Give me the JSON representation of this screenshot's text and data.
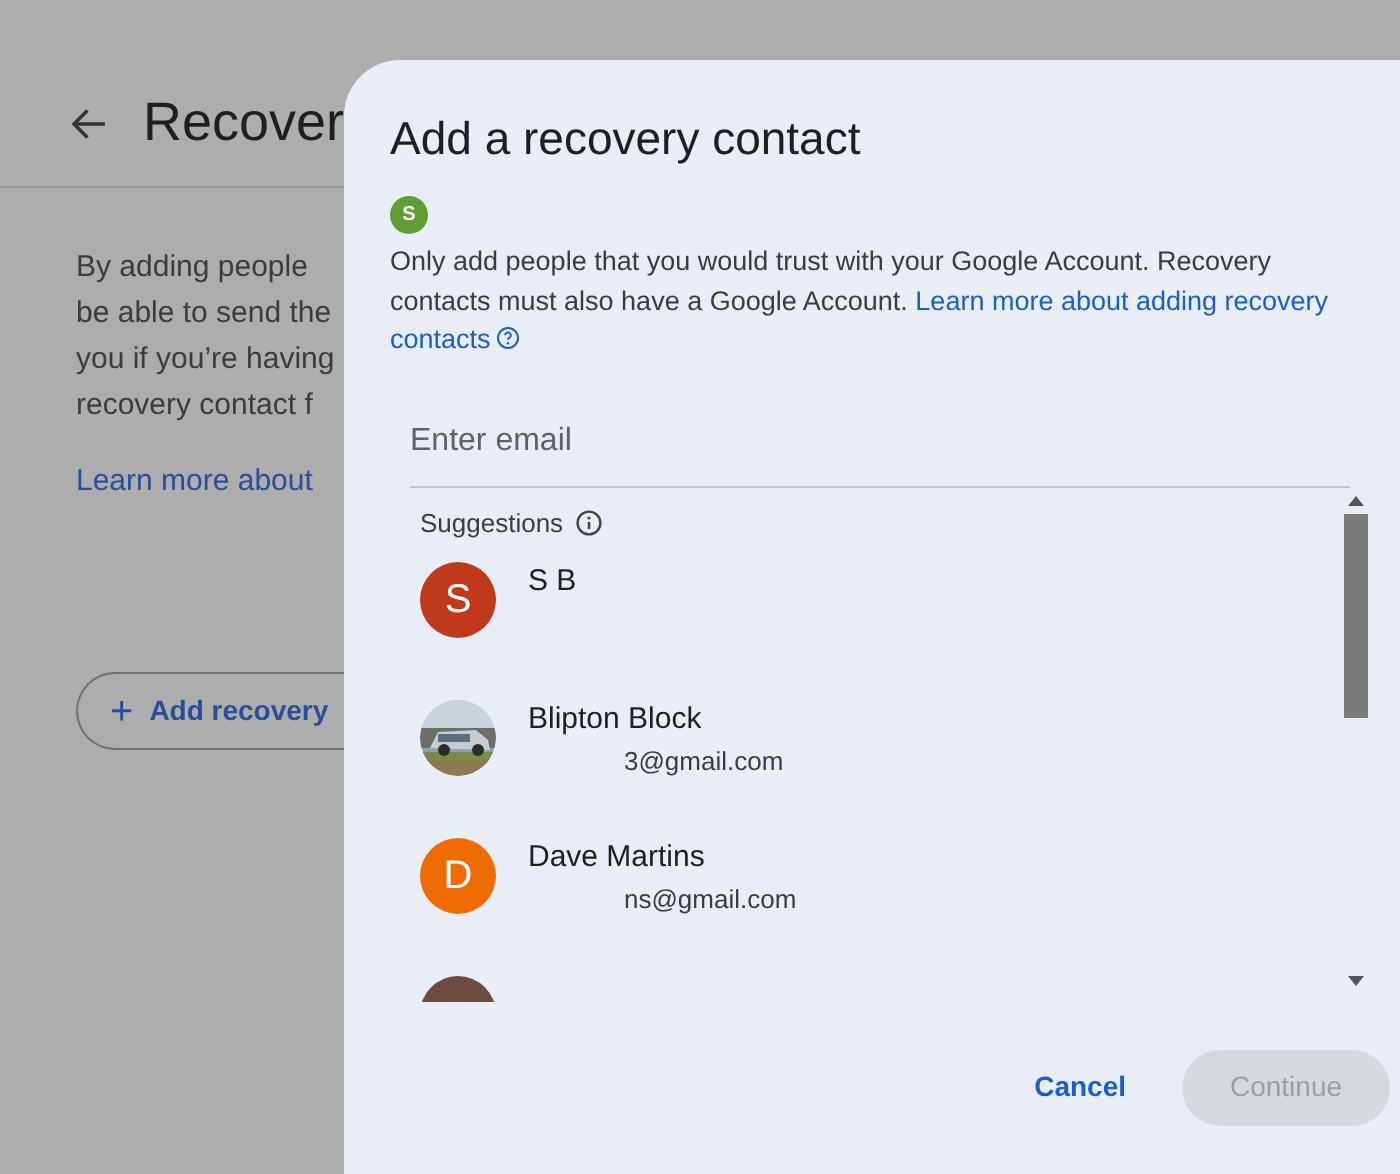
{
  "background_page": {
    "title": "Recover",
    "paragraph_lines": [
      "By adding people",
      "be able to send the",
      "you if you’re having",
      "recovery contact f"
    ],
    "link": "Learn more about",
    "add_button": {
      "label": "Add recovery",
      "icon": "+"
    }
  },
  "dialog": {
    "title": "Add a recovery contact",
    "account": {
      "initial": "S",
      "color": "#5f9e34"
    },
    "description": "Only add people that you would trust with your Google Account. Recovery contacts must also have a Google Account.",
    "learn_link_lines": [
      "Learn more about adding recovery",
      "contacts"
    ],
    "email_field": {
      "placeholder": "Enter email"
    },
    "suggestions_label": "Suggestions",
    "contacts": [
      {
        "kind": "initial",
        "initial": "S",
        "color": "#c0391b",
        "name": "S B"
      },
      {
        "kind": "picture",
        "name": "Blipton Block",
        "email": "3@gmail.com"
      },
      {
        "kind": "initial",
        "initial": "D",
        "color": "#ef6c00",
        "name": "Dave Martins",
        "email": "ns@gmail.com"
      },
      {
        "kind": "initial",
        "color": "#6d4c41"
      }
    ],
    "buttons": [
      {
        "label": "Cancel",
        "kind": "text",
        "disabled": false
      },
      {
        "label": "Continue",
        "kind": "filled",
        "disabled": true
      }
    ]
  }
}
